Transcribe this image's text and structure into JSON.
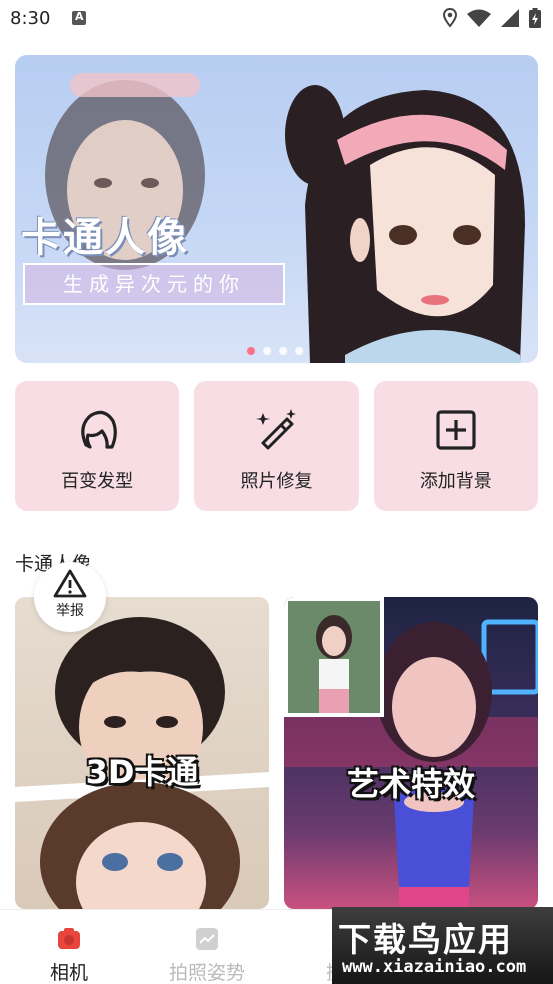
{
  "status_bar": {
    "time": "8:30",
    "icons": [
      "notification-a-icon",
      "location-icon",
      "wifi-icon",
      "signal-icon",
      "battery-charging-icon"
    ]
  },
  "banner": {
    "title": "卡通人像",
    "subtitle": "生成异次元的你",
    "page_count": 4,
    "active_page": 1
  },
  "features": [
    {
      "label": "百变发型",
      "icon": "hairstyle-icon"
    },
    {
      "label": "照片修复",
      "icon": "magic-wand-icon"
    },
    {
      "label": "添加背景",
      "icon": "add-box-icon"
    }
  ],
  "section": {
    "title": "卡通人像"
  },
  "report_button": {
    "label": "举报",
    "icon": "warning-triangle-icon"
  },
  "cards": [
    {
      "caption": "3D卡通"
    },
    {
      "caption": "艺术特效"
    }
  ],
  "bottom_nav": [
    {
      "label": "相机",
      "icon": "camera-icon",
      "active": true
    },
    {
      "label": "拍照姿势",
      "icon": "pose-image-icon",
      "active": false
    },
    {
      "label": "摄影",
      "icon": "photography-icon",
      "active": false
    }
  ],
  "watermark": {
    "title": "下载鸟应用",
    "url": "www.xiazainiao.com"
  },
  "colors": {
    "accent": "#ff6f8a",
    "card_bg": "#f8dee4",
    "nav_active_icon": "#e8453c",
    "nav_inactive": "#bbbbbb"
  }
}
